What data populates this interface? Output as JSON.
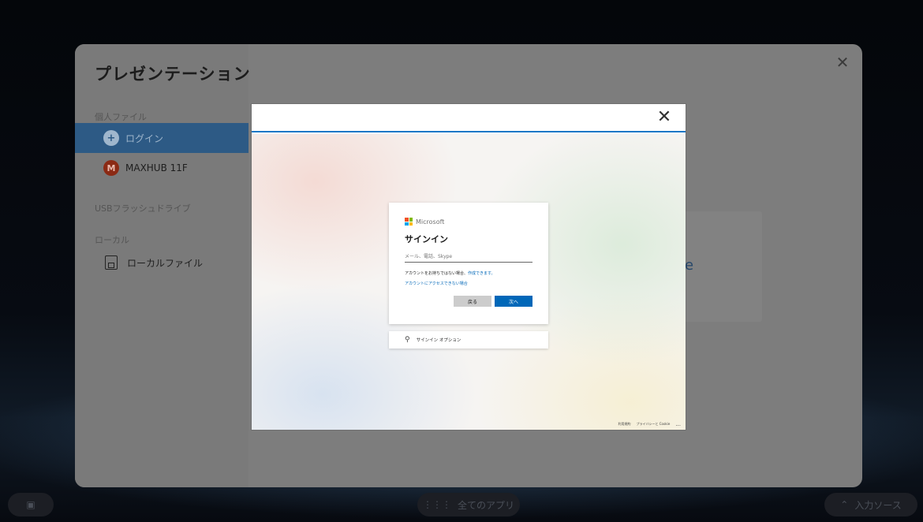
{
  "panel": {
    "title": "プレゼンテーション",
    "personal_files_label": "個人ファイル",
    "login_label": "ログイン",
    "account_label": "MAXHUB 11F",
    "account_initial": "M",
    "usb_label": "USBフラッシュドライブ",
    "local_label": "ローカル",
    "local_files_label": "ローカルファイル",
    "background_card_text": "rive"
  },
  "dialog": {
    "brand": "Microsoft",
    "title": "サインイン",
    "input_placeholder": "メール、電話、Skype",
    "no_account_text": "アカウントをお持ちではない場合、",
    "create_link": "作成できます。",
    "cant_access_link": "アカウントにアクセスできない場合",
    "back_button": "戻る",
    "next_button": "次へ",
    "options_label": "サインイン オプション",
    "footer": {
      "terms": "利用規約",
      "privacy": "プライバシーと Cookie",
      "more": "..."
    }
  },
  "taskbar": {
    "all_apps": "全てのアプリ",
    "input_source": "入力ソース"
  },
  "colors": {
    "accent": "#0067b8",
    "header_line": "#1b77c6",
    "selected_item": "#2d5a85",
    "avatar": "#8b2a14"
  }
}
